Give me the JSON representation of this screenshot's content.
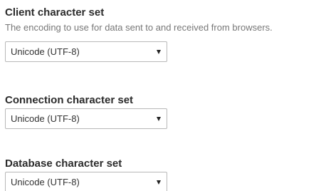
{
  "client": {
    "title": "Client character set",
    "description": "The encoding to use for data sent to and received from browsers.",
    "selected": "Unicode (UTF-8)"
  },
  "connection": {
    "title": "Connection character set",
    "selected": "Unicode (UTF-8)"
  },
  "database": {
    "title": "Database character set",
    "selected": "Unicode (UTF-8)"
  },
  "icons": {
    "dropdown": "chevron-down-icon"
  }
}
